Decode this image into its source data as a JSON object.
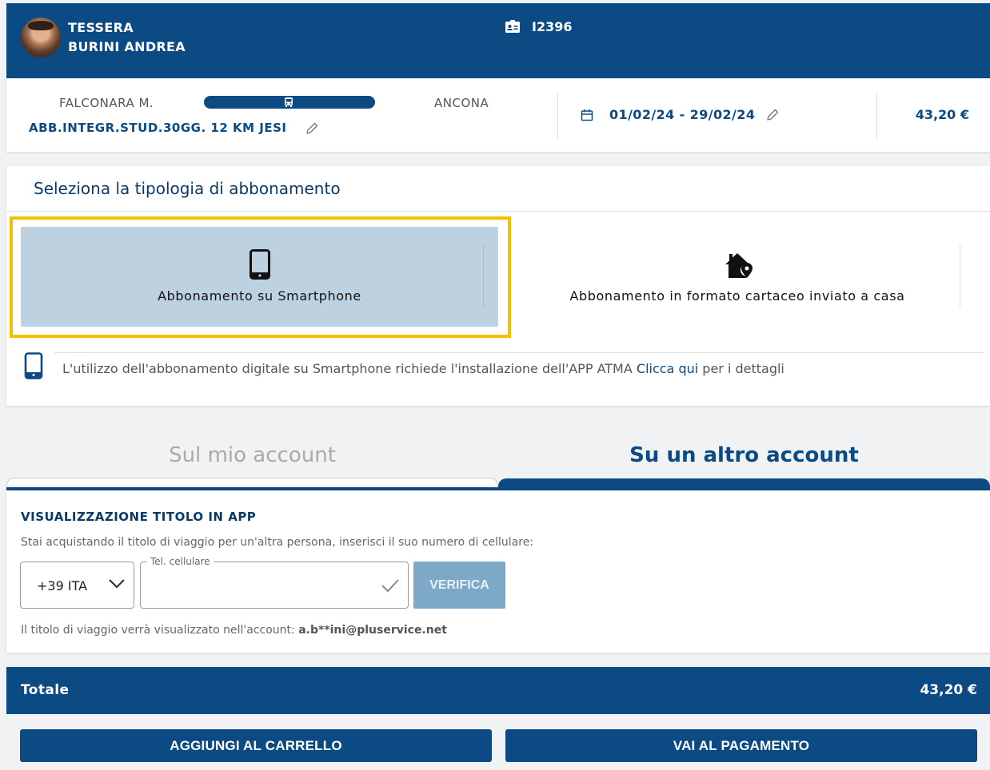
{
  "header": {
    "line1": "TESSERA",
    "line2": "BURINI ANDREA",
    "card_id": "I2396",
    "id_icon": "id-card-icon"
  },
  "route": {
    "from": "FALCONARA M.",
    "to": "ANCONA",
    "product": "ABB.INTEGR.STUD.30GG. 12 KM JESI",
    "dates": "01/02/24 - 29/02/24",
    "price": "43,20 €"
  },
  "selection": {
    "title": "Seleziona la tipologia di abbonamento",
    "options": [
      {
        "label": "Abbonamento su Smartphone",
        "icon": "smartphone-icon",
        "selected": true
      },
      {
        "label": "Abbonamento in formato cartaceo inviato a casa",
        "icon": "home-location-icon",
        "selected": false
      }
    ],
    "note_text": "L'utilizzo dell'abbonamento digitale su Smartphone richiede l'installazione dell'APP ATMA",
    "note_link": "Clicca qui",
    "note_tail": "per i dettagli"
  },
  "tabs": {
    "mine": "Sul mio account",
    "other": "Su un altro account",
    "active": "other"
  },
  "form": {
    "title": "VISUALIZZAZIONE TITOLO IN APP",
    "description": "Stai acquistando il titolo di viaggio per un'altra persona, inserisci il suo numero di cellulare:",
    "country_code": "+39 ITA",
    "phone_label": "Tel. cellulare",
    "phone_value": "",
    "verify_label": "VERIFICA",
    "footer_text": "Il titolo di viaggio verrà visualizzato nell'account:",
    "footer_account": "a.b**ini@pluservice.net"
  },
  "total": {
    "label": "Totale",
    "amount": "43,20 €"
  },
  "actions": {
    "add_to_cart": "AGGIUNGI AL CARRELLO",
    "pay": "VAI AL PAGAMENTO"
  },
  "colors": {
    "primary": "#0b4a82",
    "selected_bg": "#bed1e0",
    "highlight": "#f4c000",
    "verify_disabled": "#7ea8c8"
  }
}
